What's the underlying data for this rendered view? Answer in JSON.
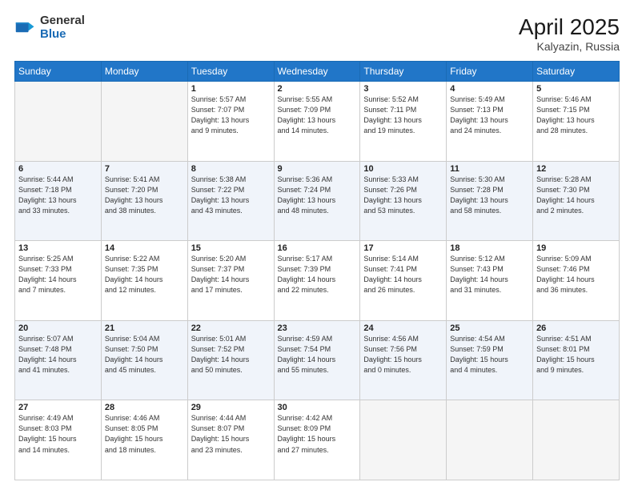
{
  "logo": {
    "general": "General",
    "blue": "Blue"
  },
  "header": {
    "month_year": "April 2025",
    "location": "Kalyazin, Russia"
  },
  "weekdays": [
    "Sunday",
    "Monday",
    "Tuesday",
    "Wednesday",
    "Thursday",
    "Friday",
    "Saturday"
  ],
  "weeks": [
    [
      {
        "day": "",
        "info": ""
      },
      {
        "day": "",
        "info": ""
      },
      {
        "day": "1",
        "info": "Sunrise: 5:57 AM\nSunset: 7:07 PM\nDaylight: 13 hours\nand 9 minutes."
      },
      {
        "day": "2",
        "info": "Sunrise: 5:55 AM\nSunset: 7:09 PM\nDaylight: 13 hours\nand 14 minutes."
      },
      {
        "day": "3",
        "info": "Sunrise: 5:52 AM\nSunset: 7:11 PM\nDaylight: 13 hours\nand 19 minutes."
      },
      {
        "day": "4",
        "info": "Sunrise: 5:49 AM\nSunset: 7:13 PM\nDaylight: 13 hours\nand 24 minutes."
      },
      {
        "day": "5",
        "info": "Sunrise: 5:46 AM\nSunset: 7:15 PM\nDaylight: 13 hours\nand 28 minutes."
      }
    ],
    [
      {
        "day": "6",
        "info": "Sunrise: 5:44 AM\nSunset: 7:18 PM\nDaylight: 13 hours\nand 33 minutes."
      },
      {
        "day": "7",
        "info": "Sunrise: 5:41 AM\nSunset: 7:20 PM\nDaylight: 13 hours\nand 38 minutes."
      },
      {
        "day": "8",
        "info": "Sunrise: 5:38 AM\nSunset: 7:22 PM\nDaylight: 13 hours\nand 43 minutes."
      },
      {
        "day": "9",
        "info": "Sunrise: 5:36 AM\nSunset: 7:24 PM\nDaylight: 13 hours\nand 48 minutes."
      },
      {
        "day": "10",
        "info": "Sunrise: 5:33 AM\nSunset: 7:26 PM\nDaylight: 13 hours\nand 53 minutes."
      },
      {
        "day": "11",
        "info": "Sunrise: 5:30 AM\nSunset: 7:28 PM\nDaylight: 13 hours\nand 58 minutes."
      },
      {
        "day": "12",
        "info": "Sunrise: 5:28 AM\nSunset: 7:30 PM\nDaylight: 14 hours\nand 2 minutes."
      }
    ],
    [
      {
        "day": "13",
        "info": "Sunrise: 5:25 AM\nSunset: 7:33 PM\nDaylight: 14 hours\nand 7 minutes."
      },
      {
        "day": "14",
        "info": "Sunrise: 5:22 AM\nSunset: 7:35 PM\nDaylight: 14 hours\nand 12 minutes."
      },
      {
        "day": "15",
        "info": "Sunrise: 5:20 AM\nSunset: 7:37 PM\nDaylight: 14 hours\nand 17 minutes."
      },
      {
        "day": "16",
        "info": "Sunrise: 5:17 AM\nSunset: 7:39 PM\nDaylight: 14 hours\nand 22 minutes."
      },
      {
        "day": "17",
        "info": "Sunrise: 5:14 AM\nSunset: 7:41 PM\nDaylight: 14 hours\nand 26 minutes."
      },
      {
        "day": "18",
        "info": "Sunrise: 5:12 AM\nSunset: 7:43 PM\nDaylight: 14 hours\nand 31 minutes."
      },
      {
        "day": "19",
        "info": "Sunrise: 5:09 AM\nSunset: 7:46 PM\nDaylight: 14 hours\nand 36 minutes."
      }
    ],
    [
      {
        "day": "20",
        "info": "Sunrise: 5:07 AM\nSunset: 7:48 PM\nDaylight: 14 hours\nand 41 minutes."
      },
      {
        "day": "21",
        "info": "Sunrise: 5:04 AM\nSunset: 7:50 PM\nDaylight: 14 hours\nand 45 minutes."
      },
      {
        "day": "22",
        "info": "Sunrise: 5:01 AM\nSunset: 7:52 PM\nDaylight: 14 hours\nand 50 minutes."
      },
      {
        "day": "23",
        "info": "Sunrise: 4:59 AM\nSunset: 7:54 PM\nDaylight: 14 hours\nand 55 minutes."
      },
      {
        "day": "24",
        "info": "Sunrise: 4:56 AM\nSunset: 7:56 PM\nDaylight: 15 hours\nand 0 minutes."
      },
      {
        "day": "25",
        "info": "Sunrise: 4:54 AM\nSunset: 7:59 PM\nDaylight: 15 hours\nand 4 minutes."
      },
      {
        "day": "26",
        "info": "Sunrise: 4:51 AM\nSunset: 8:01 PM\nDaylight: 15 hours\nand 9 minutes."
      }
    ],
    [
      {
        "day": "27",
        "info": "Sunrise: 4:49 AM\nSunset: 8:03 PM\nDaylight: 15 hours\nand 14 minutes."
      },
      {
        "day": "28",
        "info": "Sunrise: 4:46 AM\nSunset: 8:05 PM\nDaylight: 15 hours\nand 18 minutes."
      },
      {
        "day": "29",
        "info": "Sunrise: 4:44 AM\nSunset: 8:07 PM\nDaylight: 15 hours\nand 23 minutes."
      },
      {
        "day": "30",
        "info": "Sunrise: 4:42 AM\nSunset: 8:09 PM\nDaylight: 15 hours\nand 27 minutes."
      },
      {
        "day": "",
        "info": ""
      },
      {
        "day": "",
        "info": ""
      },
      {
        "day": "",
        "info": ""
      }
    ]
  ]
}
